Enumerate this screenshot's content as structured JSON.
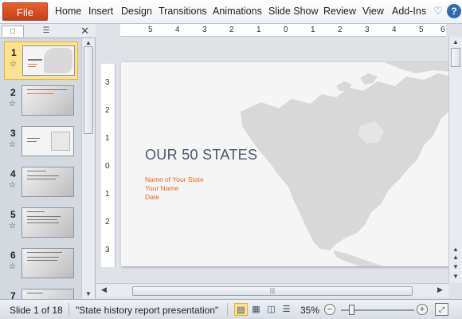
{
  "ribbon": {
    "file_label": "File",
    "tabs": [
      "Home",
      "Insert",
      "Design",
      "Transitions",
      "Animations",
      "Slide Show",
      "Review",
      "View",
      "Add-Ins"
    ]
  },
  "slide_pane": {
    "slides": [
      {
        "number": "1",
        "selected": true
      },
      {
        "number": "2",
        "selected": false
      },
      {
        "number": "3",
        "selected": false
      },
      {
        "number": "4",
        "selected": false
      },
      {
        "number": "5",
        "selected": false
      },
      {
        "number": "6",
        "selected": false
      },
      {
        "number": "7",
        "selected": false
      }
    ]
  },
  "ruler": {
    "horizontal": [
      "5",
      "4",
      "3",
      "2",
      "1",
      "0",
      "1",
      "2",
      "3",
      "4",
      "5",
      "6"
    ],
    "vertical": [
      "3",
      "2",
      "1",
      "0",
      "1",
      "2",
      "3"
    ]
  },
  "slide": {
    "title": "OUR 50 STATES",
    "subtitle_lines": [
      "Name of Your State",
      "Your Name",
      "Date"
    ]
  },
  "status_bar": {
    "slide_indicator": "Slide 1 of 18",
    "theme_name": "\"State history report presentation\"",
    "zoom_level": "35%",
    "zoom_fraction": 0.35
  },
  "colors": {
    "file_tab": "#d24f22",
    "title_text": "#4a5a6c",
    "subtitle_text": "#e0692a",
    "selection": "#fbe28f"
  }
}
